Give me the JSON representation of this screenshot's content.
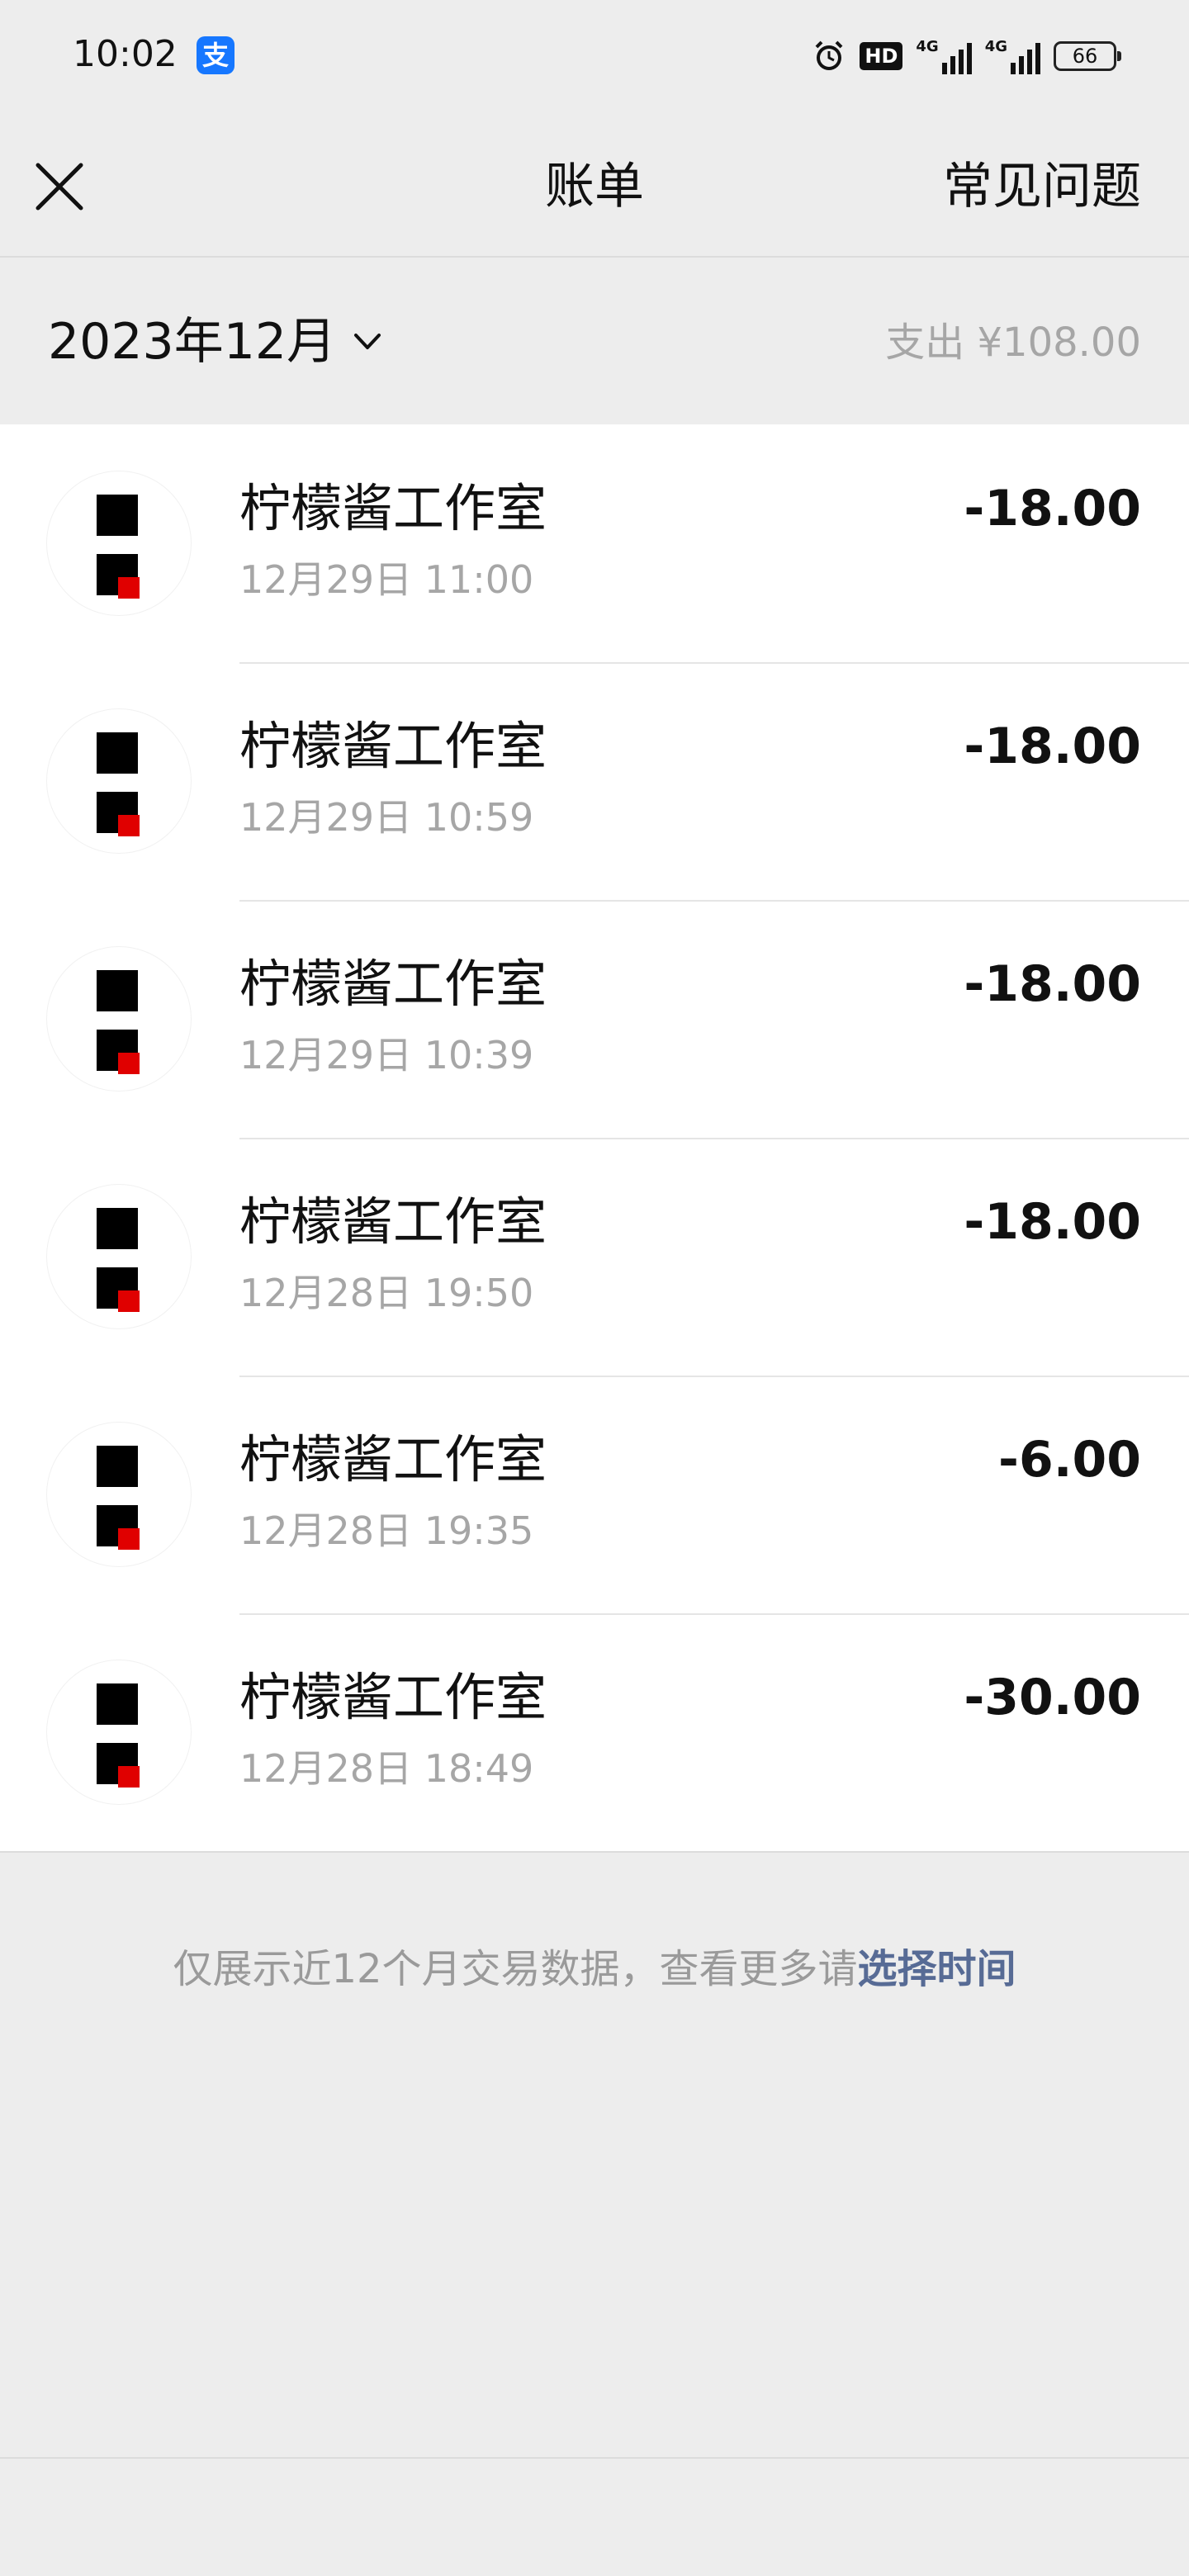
{
  "status_bar": {
    "time": "10:02",
    "app_badge_icon": "alipay-icon",
    "app_badge_glyph": "支",
    "hd_label": "HD",
    "net1": "4G",
    "net2": "4G",
    "battery": "66"
  },
  "nav": {
    "close_icon": "close-icon",
    "title": "账单",
    "faq_label": "常见问题"
  },
  "month": {
    "label": "2023年12月",
    "chevron_icon": "chevron-down-icon",
    "spend": "支出 ¥108.00"
  },
  "transactions": [
    {
      "name": "柠檬酱工作室",
      "time": "12月29日 11:00",
      "amount": "-18.00"
    },
    {
      "name": "柠檬酱工作室",
      "time": "12月29日 10:59",
      "amount": "-18.00"
    },
    {
      "name": "柠檬酱工作室",
      "time": "12月29日 10:39",
      "amount": "-18.00"
    },
    {
      "name": "柠檬酱工作室",
      "time": "12月28日 19:50",
      "amount": "-18.00"
    },
    {
      "name": "柠檬酱工作室",
      "time": "12月28日 19:35",
      "amount": "-6.00"
    },
    {
      "name": "柠檬酱工作室",
      "time": "12月28日 18:49",
      "amount": "-30.00"
    }
  ],
  "footer": {
    "note": "仅展示近12个月交易数据，查看更多请",
    "link": "选择时间"
  },
  "colors": {
    "background": "#ededed",
    "card": "#ffffff",
    "muted_text": "#a6a6a6",
    "link": "#576b95",
    "avatar_accent": "#e00000"
  }
}
